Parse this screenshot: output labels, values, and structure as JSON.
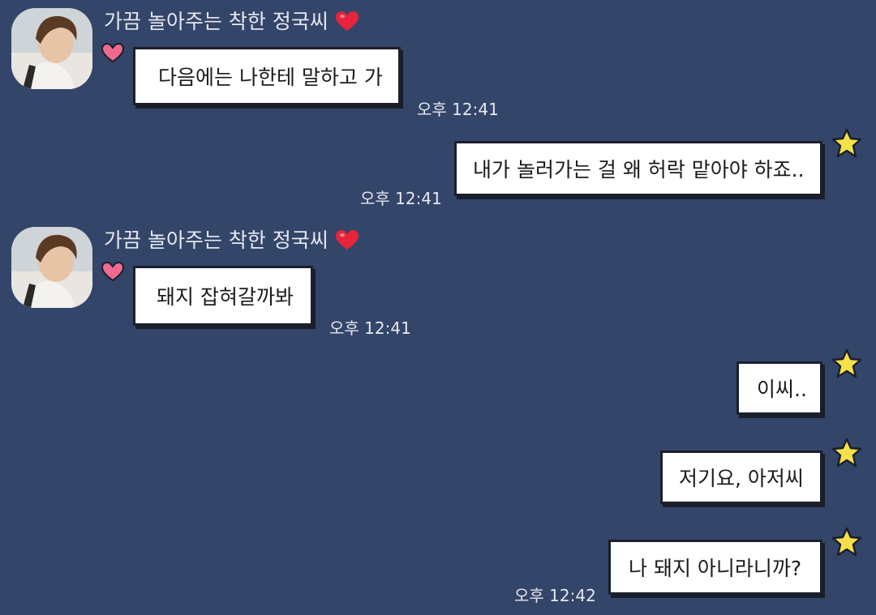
{
  "chat": {
    "sender_name": "가끔 놀아주는 착한 정국씨",
    "colors": {
      "background": "#34456a",
      "bubble": "#ffffff",
      "bubble_border": "#1b1f2b",
      "heart": "#e8243a",
      "pink_heart": "#f06a90",
      "star": "#f5e04a"
    },
    "messages": [
      {
        "side": "left",
        "text": "다음에는 나한테 말하고 가",
        "time": "오후 12:41"
      },
      {
        "side": "right",
        "text": "내가 놀러가는 걸 왜 허락 맡아야 하죠..",
        "time": "오후 12:41"
      },
      {
        "side": "left",
        "text": "돼지 잡혀갈까봐",
        "time": "오후 12:41"
      },
      {
        "side": "right",
        "text": "이씨..",
        "time": ""
      },
      {
        "side": "right",
        "text": "저기요, 아저씨",
        "time": ""
      },
      {
        "side": "right",
        "text": "나 돼지 아니라니까?",
        "time": "오후 12:42"
      }
    ]
  }
}
